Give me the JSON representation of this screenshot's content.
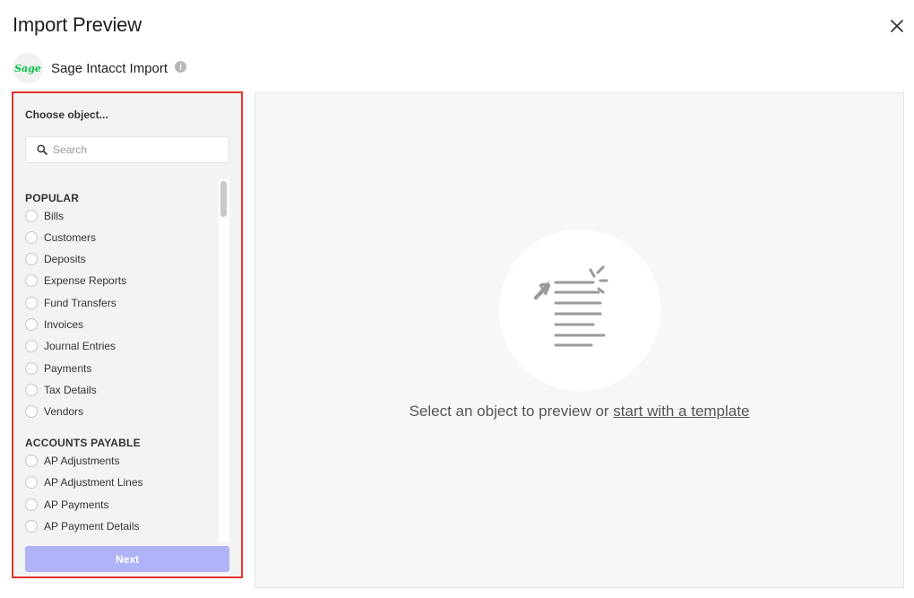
{
  "dialog": {
    "title": "Import Preview"
  },
  "source": {
    "logo_text": "Sage",
    "name": "Sage Intacct Import",
    "info_glyph": "i",
    "brand_color": "#00c244"
  },
  "picker": {
    "heading": "Choose object...",
    "search_placeholder": "Search",
    "search_value": "",
    "groups": [
      {
        "label": "POPULAR",
        "items": [
          "Bills",
          "Customers",
          "Deposits",
          "Expense Reports",
          "Fund Transfers",
          "Invoices",
          "Journal Entries",
          "Payments",
          "Tax Details",
          "Vendors"
        ]
      },
      {
        "label": "ACCOUNTS PAYABLE",
        "items": [
          "AP Adjustments",
          "AP Adjustment Lines",
          "AP Payments",
          "AP Payment Details"
        ]
      }
    ],
    "next_label": "Next",
    "next_color": "#b0b3f7",
    "highlight_border_color": "#e5342a"
  },
  "preview": {
    "message_prefix": "Select an object to preview or ",
    "template_link": "start with a template"
  }
}
